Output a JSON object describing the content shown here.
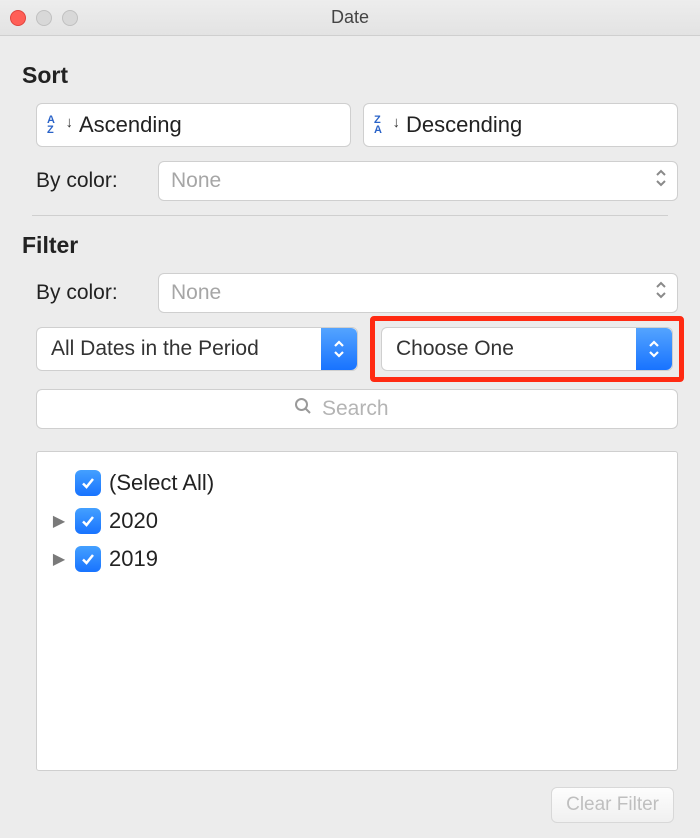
{
  "window": {
    "title": "Date"
  },
  "sort": {
    "label": "Sort",
    "asc_label": "Ascending",
    "desc_label": "Descending",
    "by_color_label": "By color:",
    "by_color_value": "None"
  },
  "filter": {
    "label": "Filter",
    "by_color_label": "By color:",
    "by_color_value": "None",
    "period_dropdown": "All Dates in the Period",
    "choice_dropdown": "Choose One",
    "search_placeholder": "Search",
    "select_all_label": "(Select All)",
    "items": [
      "2020",
      "2019"
    ],
    "clear_button": "Clear Filter"
  }
}
